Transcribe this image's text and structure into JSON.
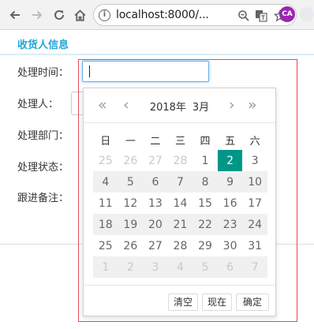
{
  "browser": {
    "url": "localhost:8000/...",
    "avatar_initials": "CA",
    "info_glyph": "i"
  },
  "section": {
    "title": "收货人信息"
  },
  "form": {
    "labels": [
      "处理时间：",
      "处理人：",
      "处理部门：",
      "处理状态：",
      "跟进备注："
    ],
    "time_value": ""
  },
  "datepicker": {
    "prev_year": "«",
    "prev_month": "‹",
    "next_month": "›",
    "next_year": "»",
    "year": "2018年",
    "month": "3月",
    "weekdays": [
      "日",
      "一",
      "二",
      "三",
      "四",
      "五",
      "六"
    ],
    "weeks": [
      [
        {
          "d": "25",
          "m": true
        },
        {
          "d": "26",
          "m": true
        },
        {
          "d": "27",
          "m": true
        },
        {
          "d": "28",
          "m": true
        },
        {
          "d": "1"
        },
        {
          "d": "2",
          "s": true
        },
        {
          "d": "3"
        }
      ],
      [
        {
          "d": "4"
        },
        {
          "d": "5"
        },
        {
          "d": "6"
        },
        {
          "d": "7"
        },
        {
          "d": "8"
        },
        {
          "d": "9"
        },
        {
          "d": "10"
        }
      ],
      [
        {
          "d": "11"
        },
        {
          "d": "12"
        },
        {
          "d": "13"
        },
        {
          "d": "14"
        },
        {
          "d": "15"
        },
        {
          "d": "16"
        },
        {
          "d": "17"
        }
      ],
      [
        {
          "d": "18"
        },
        {
          "d": "19"
        },
        {
          "d": "20"
        },
        {
          "d": "21"
        },
        {
          "d": "22"
        },
        {
          "d": "23"
        },
        {
          "d": "24"
        }
      ],
      [
        {
          "d": "25"
        },
        {
          "d": "26"
        },
        {
          "d": "27"
        },
        {
          "d": "28"
        },
        {
          "d": "29"
        },
        {
          "d": "30"
        },
        {
          "d": "31"
        }
      ],
      [
        {
          "d": "1",
          "m": true
        },
        {
          "d": "2",
          "m": true
        },
        {
          "d": "3",
          "m": true
        },
        {
          "d": "4",
          "m": true
        },
        {
          "d": "5",
          "m": true
        },
        {
          "d": "6",
          "m": true
        },
        {
          "d": "7",
          "m": true
        }
      ]
    ],
    "selected_day": "2",
    "buttons": {
      "clear": "清空",
      "now": "现在",
      "confirm": "确定"
    }
  },
  "colors": {
    "accent": "#23a6d5",
    "selected": "#009688",
    "debug_outline": "#e14b5a",
    "focus": "#66afe9"
  }
}
